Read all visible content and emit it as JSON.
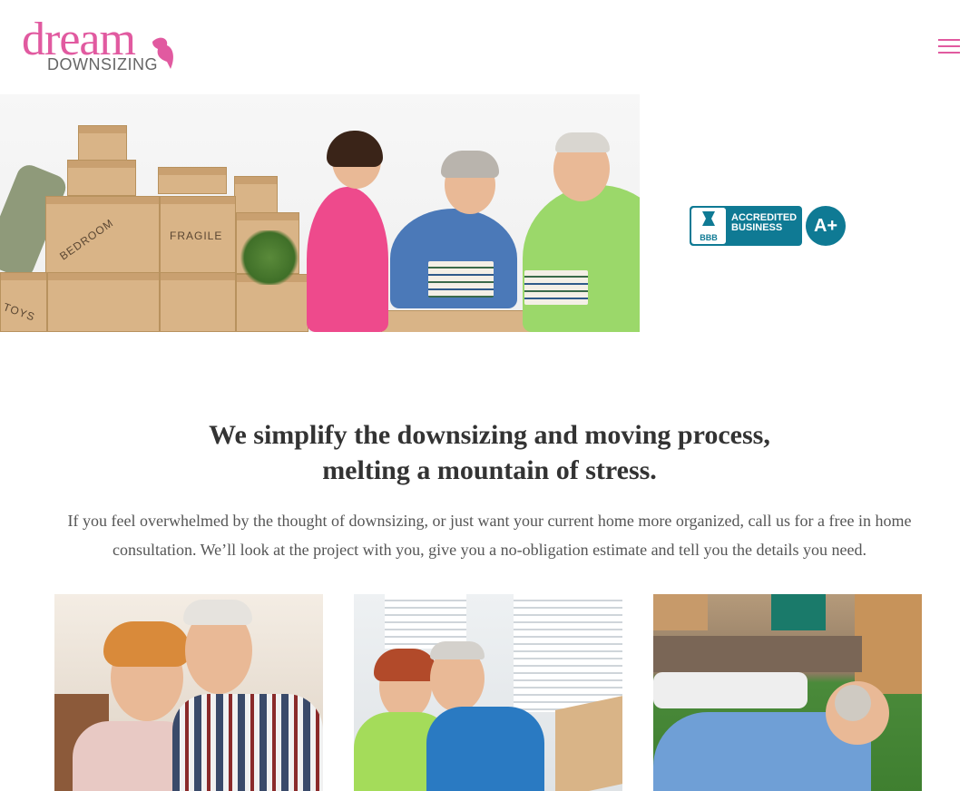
{
  "brand": {
    "logo_top": "dream",
    "logo_bottom": "DOWNSIZING",
    "primary_color": "#e15aa0"
  },
  "nav": {
    "menu_icon": "hamburger-menu-icon"
  },
  "hero": {
    "box_labels": [
      "BEDROOM",
      "FRAGILE",
      "TOYS"
    ],
    "bbb": {
      "logo_text": "BBB",
      "line1": "ACCREDITED",
      "line2": "BUSINESS",
      "grade": "A+",
      "color": "#0f7a94"
    }
  },
  "intro": {
    "headline_line1": "We simplify the downsizing and moving process,",
    "headline_line2": "melting a mountain of stress.",
    "body": "If you feel overwhelmed by the thought of downsizing, or just want your current home more organized, call us for a free in home consultation. We’ll look at the project with you, give you a no-obligation estimate and tell you the details you need."
  }
}
